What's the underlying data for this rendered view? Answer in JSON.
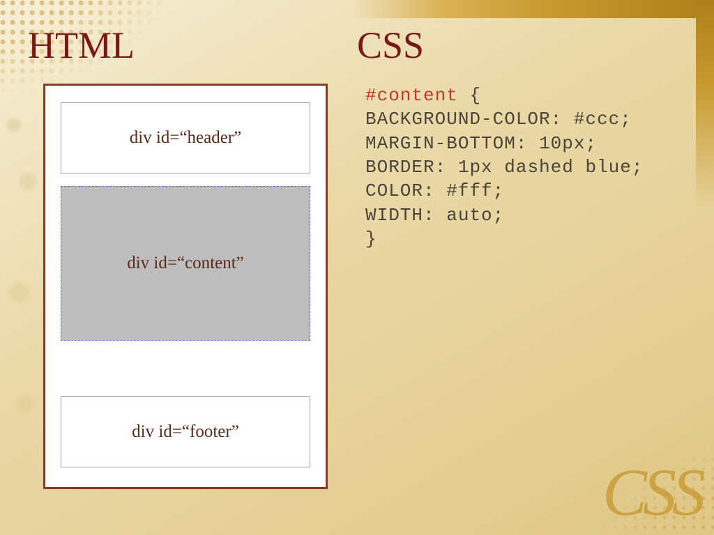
{
  "titles": {
    "left": "HTML",
    "right": "CSS"
  },
  "diagram": {
    "header": "div id=“header”",
    "content": "div id=“content”",
    "footer": "div id=“footer”"
  },
  "css": {
    "selector": "#content",
    "open": "{",
    "close": "}",
    "lines": [
      {
        "prop": "background-color",
        "val": "#ccc"
      },
      {
        "prop": "margin-bottom",
        "val": "10px"
      },
      {
        "prop": "border",
        "val": "1px dashed blue"
      },
      {
        "prop": "color",
        "val": "#fff"
      },
      {
        "prop": "width",
        "val": "auto"
      }
    ]
  },
  "decor": {
    "script": "CSS"
  },
  "colors": {
    "heading": "#7a1818",
    "diagram_content_bg": "#bdbdbd",
    "diagram_content_border": "#4a73d4",
    "frame_border": "#8a3a22",
    "code_selector": "#c0392b"
  }
}
